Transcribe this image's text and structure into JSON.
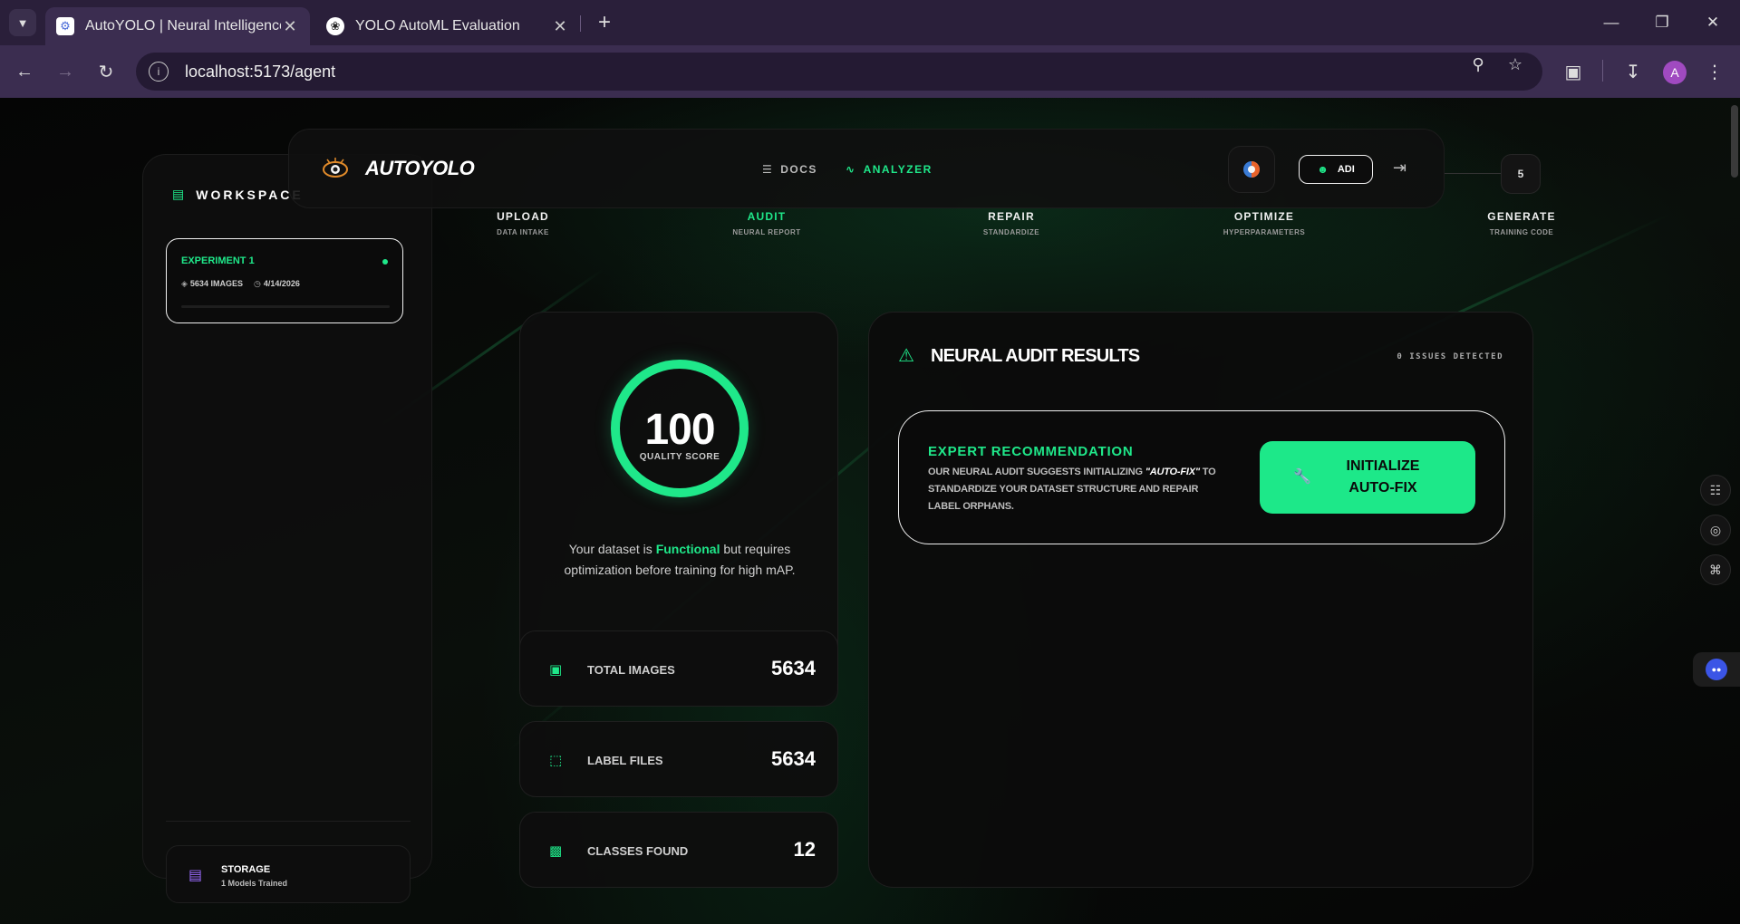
{
  "browser": {
    "tabs": [
      {
        "label": "AutoYOLO | Neural Intelligence",
        "active": true
      },
      {
        "label": "YOLO AutoML Evaluation",
        "active": false
      }
    ],
    "url": "localhost:5173/agent",
    "profile_initial": "A"
  },
  "sidebar": {
    "title": "WORKSPACE",
    "experiment": {
      "name": "EXPERIMENT 1",
      "images": "5634 IMAGES",
      "date": "4/14/2026"
    },
    "storage": {
      "title": "STORAGE",
      "subtitle": "1 Models Trained"
    }
  },
  "topnav": {
    "logo": "AUTOYOLO",
    "docs": "DOCS",
    "analyzer": "ANALYZER",
    "user": "ADI"
  },
  "stepper": {
    "current_number": "5",
    "steps": [
      {
        "label": "UPLOAD",
        "sub": "DATA INTAKE",
        "active": false
      },
      {
        "label": "AUDIT",
        "sub": "NEURAL REPORT",
        "active": true
      },
      {
        "label": "REPAIR",
        "sub": "STANDARDIZE",
        "active": false
      },
      {
        "label": "OPTIMIZE",
        "sub": "HYPERPARAMETERS",
        "active": false
      },
      {
        "label": "GENERATE",
        "sub": "TRAINING CODE",
        "active": false
      }
    ]
  },
  "score": {
    "value": "100",
    "label": "QUALITY SCORE",
    "text_prefix": "Your dataset is ",
    "text_highlight": "Functional",
    "text_suffix": " but requires optimization before training for high mAP."
  },
  "stats": [
    {
      "label": "TOTAL IMAGES",
      "value": "5634",
      "icon": "image-icon"
    },
    {
      "label": "LABEL FILES",
      "value": "5634",
      "icon": "label-box-icon"
    },
    {
      "label": "CLASSES FOUND",
      "value": "12",
      "icon": "bar-chart-icon"
    }
  ],
  "audit": {
    "title": "NEURAL AUDIT RESULTS",
    "issues": "0 ISSUES DETECTED",
    "recommendation_title": "EXPERT RECOMMENDATION",
    "recommendation_pre": "OUR NEURAL AUDIT SUGGESTS INITIALIZING ",
    "recommendation_em": "\"AUTO-FIX\"",
    "recommendation_post": " TO STANDARDIZE YOUR DATASET STRUCTURE AND REPAIR LABEL ORPHANS.",
    "button": "INITIALIZE AUTO-FIX"
  },
  "colors": {
    "accent": "#1fe88a",
    "background": "#0a0a0a",
    "storage_icon": "#9b6bff"
  }
}
